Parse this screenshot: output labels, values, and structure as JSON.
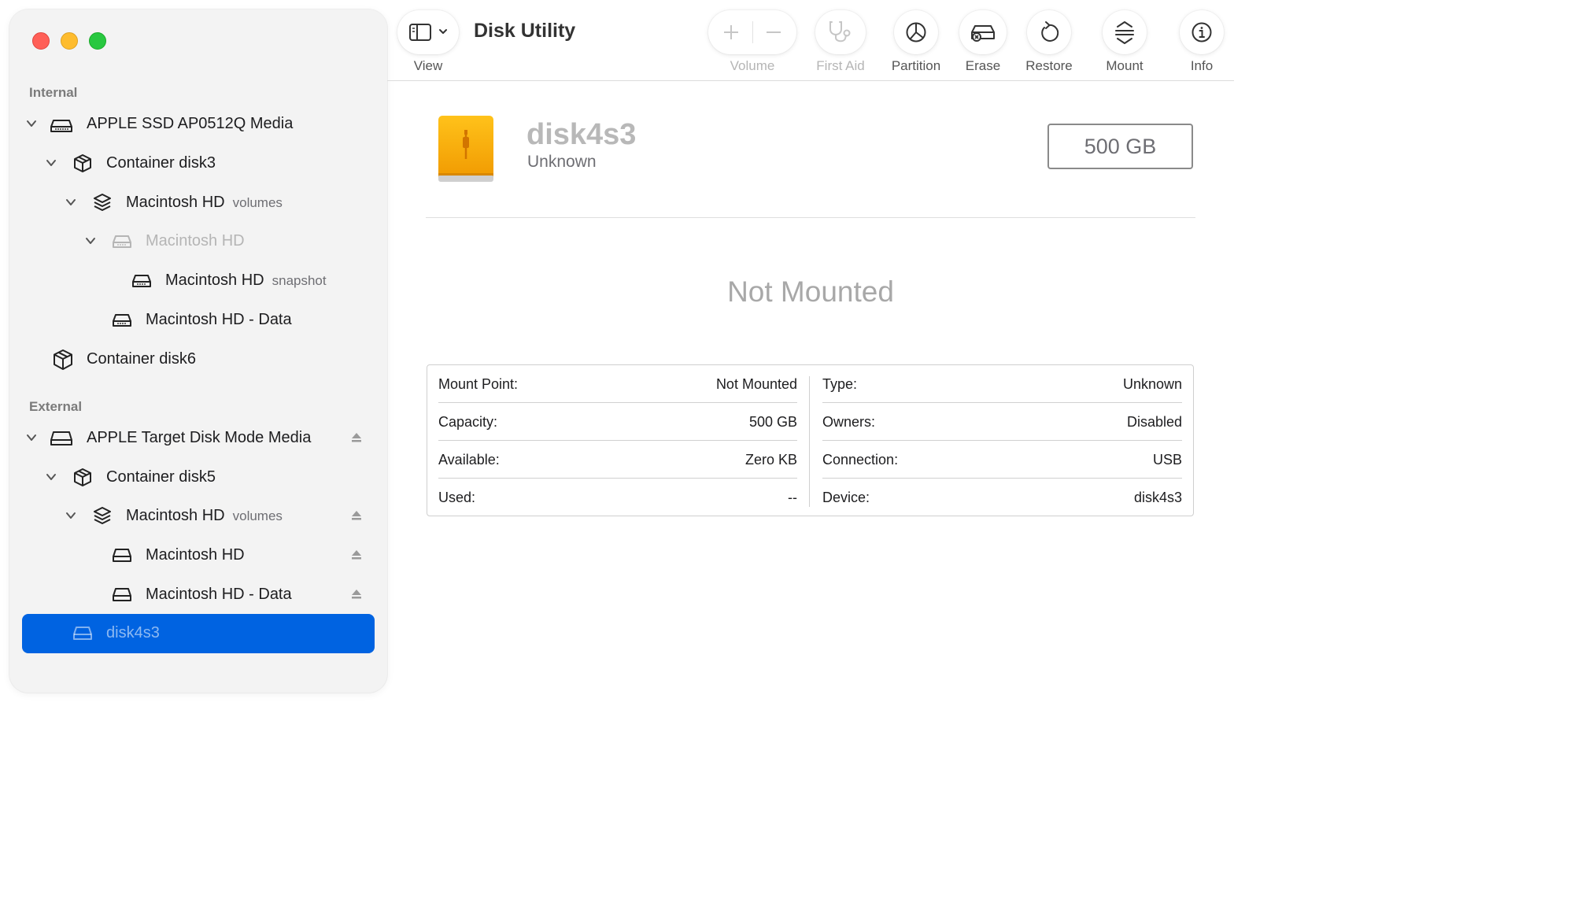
{
  "app": {
    "title": "Disk Utility"
  },
  "toolbar": {
    "view": "View",
    "volume": "Volume",
    "first_aid": "First Aid",
    "partition": "Partition",
    "erase": "Erase",
    "restore": "Restore",
    "mount": "Mount",
    "info": "Info"
  },
  "sidebar": {
    "internal_header": "Internal",
    "external_header": "External",
    "internal": [
      {
        "label": "APPLE SSD AP0512Q Media",
        "sub": "",
        "icon": "internal-drive-icon"
      },
      {
        "label": "Container disk3",
        "sub": "",
        "icon": "container-icon"
      },
      {
        "label": "Macintosh HD",
        "sub": "volumes",
        "icon": "volume-group-icon"
      },
      {
        "label": "Macintosh HD",
        "sub": "",
        "icon": "volume-icon",
        "dimmed": true
      },
      {
        "label": "Macintosh HD",
        "sub": "snapshot",
        "icon": "volume-icon"
      },
      {
        "label": "Macintosh HD - Data",
        "sub": "",
        "icon": "volume-icon"
      },
      {
        "label": "Container disk6",
        "sub": "",
        "icon": "container-icon"
      }
    ],
    "external": [
      {
        "label": "APPLE Target Disk Mode Media",
        "sub": "",
        "icon": "external-drive-icon",
        "eject": true
      },
      {
        "label": "Container disk5",
        "sub": "",
        "icon": "container-icon"
      },
      {
        "label": "Macintosh HD",
        "sub": "volumes",
        "icon": "volume-group-icon",
        "eject": true
      },
      {
        "label": "Macintosh HD",
        "sub": "",
        "icon": "external-volume-icon",
        "eject": true
      },
      {
        "label": "Macintosh HD - Data",
        "sub": "",
        "icon": "external-volume-icon",
        "eject": true
      },
      {
        "label": "disk4s3",
        "sub": "",
        "icon": "external-volume-icon",
        "selected": true
      }
    ]
  },
  "main": {
    "disk_name": "disk4s3",
    "disk_subtitle": "Unknown",
    "size": "500 GB",
    "status": "Not Mounted",
    "info_left": [
      {
        "key": "Mount Point:",
        "value": "Not Mounted"
      },
      {
        "key": "Capacity:",
        "value": "500 GB"
      },
      {
        "key": "Available:",
        "value": "Zero KB"
      },
      {
        "key": "Used:",
        "value": "--"
      }
    ],
    "info_right": [
      {
        "key": "Type:",
        "value": "Unknown"
      },
      {
        "key": "Owners:",
        "value": "Disabled"
      },
      {
        "key": "Connection:",
        "value": "USB"
      },
      {
        "key": "Device:",
        "value": "disk4s3"
      }
    ]
  },
  "colors": {
    "selection": "#0063e1",
    "disk_icon": "#f5a800",
    "close": "#ff5f57",
    "minimize": "#febc2e",
    "zoom": "#28c840"
  }
}
